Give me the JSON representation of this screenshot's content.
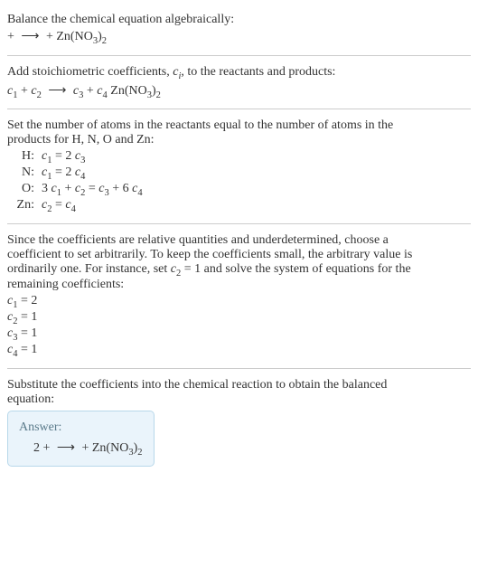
{
  "intro": {
    "line1": "Balance the chemical equation algebraically:",
    "reaction_lhs1": " + ",
    "reaction_arrow": "⟶",
    "reaction_rhs1": " + Zn(NO",
    "reaction_rhs1_sub": "3",
    "reaction_rhs1_close": ")",
    "reaction_rhs1_sub2": "2"
  },
  "stoich": {
    "line1_a": "Add stoichiometric coefficients, ",
    "line1_ci": "c",
    "line1_ci_sub": "i",
    "line1_b": ", to the reactants and products:",
    "c1": "c",
    "c1_sub": "1",
    "plus1": " + ",
    "c2": "c",
    "c2_sub": "2",
    "arrow": "⟶",
    "c3": "c",
    "c3_sub": "3",
    "plus2": " + ",
    "c4": "c",
    "c4_sub": "4",
    "compound": " Zn(NO",
    "compound_sub": "3",
    "compound_close": ")",
    "compound_sub2": "2"
  },
  "atoms": {
    "intro_a": "Set the number of atoms in the reactants equal to the number of atoms in the",
    "intro_b": "products for H, N, O and Zn:",
    "rows": {
      "H": {
        "label": "H:",
        "c1": "c",
        "c1s": "1",
        "eq": " = 2 ",
        "c3": "c",
        "c3s": "3"
      },
      "N": {
        "label": "N:",
        "c1": "c",
        "c1s": "1",
        "eq": " = 2 ",
        "c4": "c",
        "c4s": "4"
      },
      "O": {
        "label": "O:",
        "three": "3 ",
        "c1": "c",
        "c1s": "1",
        "plus": " + ",
        "c2": "c",
        "c2s": "2",
        "eq": " = ",
        "c3": "c",
        "c3s": "3",
        "plus2": " + 6 ",
        "c4": "c",
        "c4s": "4"
      },
      "Zn": {
        "label": "Zn:",
        "c2": "c",
        "c2s": "2",
        "eq": " = ",
        "c4": "c",
        "c4s": "4"
      }
    }
  },
  "choose": {
    "p1": "Since the coefficients are relative quantities and underdetermined, choose a",
    "p2a": "coefficient to set arbitrarily. To keep the coefficients small, the arbitrary value is",
    "p2b": "ordinarily one. For instance, set ",
    "c2": "c",
    "c2s": "2",
    "p2c": " = 1 and solve the system of equations for the",
    "p3": "remaining coefficients:",
    "coeffs": {
      "c1": {
        "c": "c",
        "s": "1",
        "eq": " = 2"
      },
      "c2": {
        "c": "c",
        "s": "2",
        "eq": " = 1"
      },
      "c3": {
        "c": "c",
        "s": "3",
        "eq": " = 1"
      },
      "c4": {
        "c": "c",
        "s": "4",
        "eq": " = 1"
      }
    }
  },
  "sub": {
    "p1": "Substitute the coefficients into the chemical reaction to obtain the balanced",
    "p2": "equation:"
  },
  "answer": {
    "label": "Answer:",
    "eq_a": "2  +  ",
    "arrow": "⟶",
    "eq_b": "  + Zn(NO",
    "eq_sub1": "3",
    "eq_c": ")",
    "eq_sub2": "2"
  }
}
